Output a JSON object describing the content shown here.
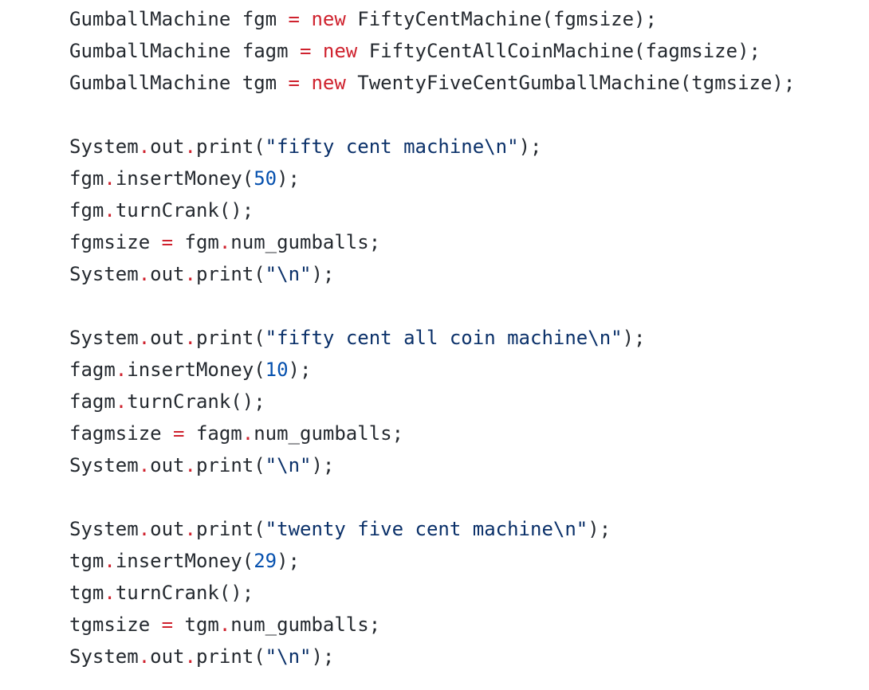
{
  "colors": {
    "background": "#ffffff",
    "text": "#24292f",
    "keyword": "#cf222e",
    "operator": "#cf222e",
    "string": "#0a3069",
    "number": "#0550ae"
  },
  "code": {
    "language": "java",
    "lines": [
      [
        {
          "t": "plain",
          "v": "GumballMachine fgm "
        },
        {
          "t": "operator",
          "v": "="
        },
        {
          "t": "plain",
          "v": " "
        },
        {
          "t": "keyword",
          "v": "new"
        },
        {
          "t": "plain",
          "v": " FiftyCentMachine(fgmsize);"
        }
      ],
      [
        {
          "t": "plain",
          "v": "GumballMachine fagm "
        },
        {
          "t": "operator",
          "v": "="
        },
        {
          "t": "plain",
          "v": " "
        },
        {
          "t": "keyword",
          "v": "new"
        },
        {
          "t": "plain",
          "v": " FiftyCentAllCoinMachine(fagmsize);"
        }
      ],
      [
        {
          "t": "plain",
          "v": "GumballMachine tgm "
        },
        {
          "t": "operator",
          "v": "="
        },
        {
          "t": "plain",
          "v": " "
        },
        {
          "t": "keyword",
          "v": "new"
        },
        {
          "t": "plain",
          "v": " TwentyFiveCentGumballMachine(tgmsize);"
        }
      ],
      [],
      [
        {
          "t": "plain",
          "v": "System"
        },
        {
          "t": "dot",
          "v": "."
        },
        {
          "t": "plain",
          "v": "out"
        },
        {
          "t": "dot",
          "v": "."
        },
        {
          "t": "plain",
          "v": "print("
        },
        {
          "t": "string",
          "v": "\"fifty cent machine\\n\""
        },
        {
          "t": "plain",
          "v": ");"
        }
      ],
      [
        {
          "t": "plain",
          "v": "fgm"
        },
        {
          "t": "dot",
          "v": "."
        },
        {
          "t": "plain",
          "v": "insertMoney("
        },
        {
          "t": "number",
          "v": "50"
        },
        {
          "t": "plain",
          "v": ");"
        }
      ],
      [
        {
          "t": "plain",
          "v": "fgm"
        },
        {
          "t": "dot",
          "v": "."
        },
        {
          "t": "plain",
          "v": "turnCrank();"
        }
      ],
      [
        {
          "t": "plain",
          "v": "fgmsize "
        },
        {
          "t": "operator",
          "v": "="
        },
        {
          "t": "plain",
          "v": " fgm"
        },
        {
          "t": "dot",
          "v": "."
        },
        {
          "t": "plain",
          "v": "num_gumballs;"
        }
      ],
      [
        {
          "t": "plain",
          "v": "System"
        },
        {
          "t": "dot",
          "v": "."
        },
        {
          "t": "plain",
          "v": "out"
        },
        {
          "t": "dot",
          "v": "."
        },
        {
          "t": "plain",
          "v": "print("
        },
        {
          "t": "string",
          "v": "\"\\n\""
        },
        {
          "t": "plain",
          "v": ");"
        }
      ],
      [],
      [
        {
          "t": "plain",
          "v": "System"
        },
        {
          "t": "dot",
          "v": "."
        },
        {
          "t": "plain",
          "v": "out"
        },
        {
          "t": "dot",
          "v": "."
        },
        {
          "t": "plain",
          "v": "print("
        },
        {
          "t": "string",
          "v": "\"fifty cent all coin machine\\n\""
        },
        {
          "t": "plain",
          "v": ");"
        }
      ],
      [
        {
          "t": "plain",
          "v": "fagm"
        },
        {
          "t": "dot",
          "v": "."
        },
        {
          "t": "plain",
          "v": "insertMoney("
        },
        {
          "t": "number",
          "v": "10"
        },
        {
          "t": "plain",
          "v": ");"
        }
      ],
      [
        {
          "t": "plain",
          "v": "fagm"
        },
        {
          "t": "dot",
          "v": "."
        },
        {
          "t": "plain",
          "v": "turnCrank();"
        }
      ],
      [
        {
          "t": "plain",
          "v": "fagmsize "
        },
        {
          "t": "operator",
          "v": "="
        },
        {
          "t": "plain",
          "v": " fagm"
        },
        {
          "t": "dot",
          "v": "."
        },
        {
          "t": "plain",
          "v": "num_gumballs;"
        }
      ],
      [
        {
          "t": "plain",
          "v": "System"
        },
        {
          "t": "dot",
          "v": "."
        },
        {
          "t": "plain",
          "v": "out"
        },
        {
          "t": "dot",
          "v": "."
        },
        {
          "t": "plain",
          "v": "print("
        },
        {
          "t": "string",
          "v": "\"\\n\""
        },
        {
          "t": "plain",
          "v": ");"
        }
      ],
      [],
      [
        {
          "t": "plain",
          "v": "System"
        },
        {
          "t": "dot",
          "v": "."
        },
        {
          "t": "plain",
          "v": "out"
        },
        {
          "t": "dot",
          "v": "."
        },
        {
          "t": "plain",
          "v": "print("
        },
        {
          "t": "string",
          "v": "\"twenty five cent machine\\n\""
        },
        {
          "t": "plain",
          "v": ");"
        }
      ],
      [
        {
          "t": "plain",
          "v": "tgm"
        },
        {
          "t": "dot",
          "v": "."
        },
        {
          "t": "plain",
          "v": "insertMoney("
        },
        {
          "t": "number",
          "v": "29"
        },
        {
          "t": "plain",
          "v": ");"
        }
      ],
      [
        {
          "t": "plain",
          "v": "tgm"
        },
        {
          "t": "dot",
          "v": "."
        },
        {
          "t": "plain",
          "v": "turnCrank();"
        }
      ],
      [
        {
          "t": "plain",
          "v": "tgmsize "
        },
        {
          "t": "operator",
          "v": "="
        },
        {
          "t": "plain",
          "v": " tgm"
        },
        {
          "t": "dot",
          "v": "."
        },
        {
          "t": "plain",
          "v": "num_gumballs;"
        }
      ],
      [
        {
          "t": "plain",
          "v": "System"
        },
        {
          "t": "dot",
          "v": "."
        },
        {
          "t": "plain",
          "v": "out"
        },
        {
          "t": "dot",
          "v": "."
        },
        {
          "t": "plain",
          "v": "print("
        },
        {
          "t": "string",
          "v": "\"\\n\""
        },
        {
          "t": "plain",
          "v": ");"
        }
      ]
    ]
  }
}
